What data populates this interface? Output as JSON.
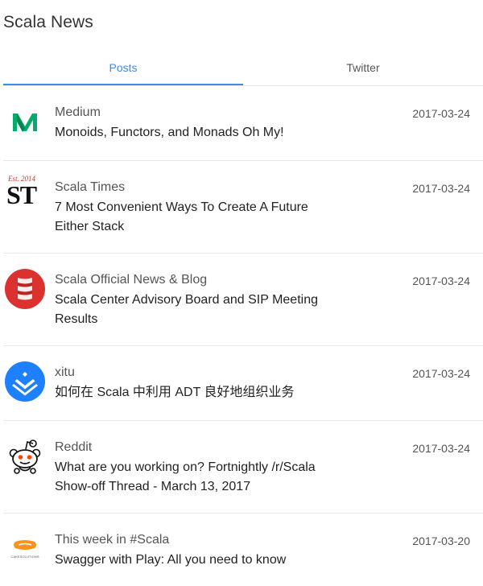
{
  "app": {
    "title": "Scala News"
  },
  "tabs": [
    {
      "label": "Posts",
      "active": true
    },
    {
      "label": "Twitter",
      "active": false
    }
  ],
  "colors": {
    "accent": "#3a8ee6",
    "medium_green": "#00ab6c",
    "scala_red": "#dc322f",
    "xitu_blue": "#1e80ff",
    "reddit_orange": "#ff4500",
    "cake_orange": "#f7941d"
  },
  "news": [
    {
      "source": "Medium",
      "headline": "Monoids, Functors, and Monads Oh My!",
      "date": "2017-03-24",
      "icon": "medium-logo"
    },
    {
      "source": "Scala Times",
      "headline": "7 Most Convenient Ways To Create A Future Either Stack",
      "date": "2017-03-24",
      "icon": "scala-times-logo",
      "logo_text": "ST",
      "logo_est": "Est. 2014"
    },
    {
      "source": "Scala Official News & Blog",
      "headline": "Scala Center Advisory Board and SIP Meeting Results",
      "date": "2017-03-24",
      "icon": "scala-logo"
    },
    {
      "source": "xitu",
      "headline": "如何在 Scala 中利用 ADT 良好地组织业务",
      "date": "2017-03-24",
      "icon": "xitu-logo"
    },
    {
      "source": "Reddit",
      "headline": "What are you working on? Fortnightly /r/Scala Show-off Thread - March 13, 2017",
      "date": "2017-03-24",
      "icon": "reddit-logo"
    },
    {
      "source": "This week in #Scala",
      "headline": "Swagger with Play: All you need to know",
      "date": "2017-03-20",
      "icon": "cake-solutions-logo",
      "logo_text": "CAKESOLUTIONS"
    }
  ]
}
